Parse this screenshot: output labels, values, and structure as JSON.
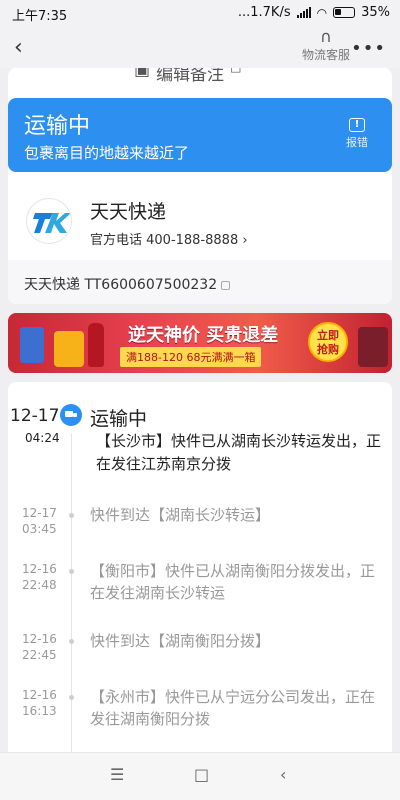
{
  "status_bar": {
    "time": "上午7:35",
    "speed": "...1.7K/s",
    "battery": "35%"
  },
  "nav": {
    "service_label": "物流客服"
  },
  "top_note": {
    "text": "编辑备注"
  },
  "banner": {
    "status": "运输中",
    "subtitle": "包裹离目的地越来越近了",
    "report_label": "报错",
    "color": "#2d8ff0"
  },
  "carrier": {
    "name": "天天快递",
    "logo_text": "TK",
    "phone": "官方电话 400-188-8888 ›",
    "tracking": "天天快递 TT6600607500232"
  },
  "ad": {
    "headline": "逆天神价 买贵退差",
    "deal": "满188-120 68元满满一箱",
    "cta_line1": "立即",
    "cta_line2": "抢购"
  },
  "timeline": {
    "current": {
      "date": "12-17",
      "time": "04:24",
      "status": "运输中",
      "desc": "【长沙市】快件已从湖南长沙转运发出，正在发往江苏南京分拨"
    },
    "events": [
      {
        "date": "12-17",
        "time": "03:45",
        "desc": "快件到达【湖南长沙转运】"
      },
      {
        "date": "12-16",
        "time": "22:48",
        "desc": "【衡阳市】快件已从湖南衡阳分拨发出，正在发往湖南长沙转运"
      },
      {
        "date": "12-16",
        "time": "22:45",
        "desc": "快件到达【湖南衡阳分拨】"
      },
      {
        "date": "12-16",
        "time": "16:13",
        "desc": "【永州市】快件已从宁远分公司发出，正在发往湖南衡阳分拨"
      }
    ]
  },
  "bottom_nav": {
    "menu": "☰",
    "home": "□",
    "back": "‹"
  }
}
